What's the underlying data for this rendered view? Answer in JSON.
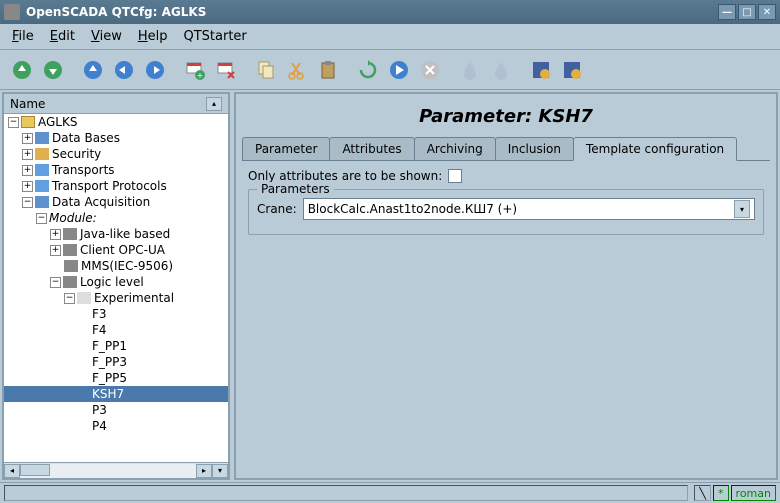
{
  "title": "OpenSCADA QTCfg: AGLKS",
  "menu": {
    "file": "File",
    "edit": "Edit",
    "view": "View",
    "help": "Help",
    "qtstarter": "QTStarter"
  },
  "tree": {
    "header": "Name",
    "root": "AGLKS",
    "databases": "Data Bases",
    "security": "Security",
    "transports": "Transports",
    "transport_protocols": "Transport Protocols",
    "data_acquisition": "Data Acquisition",
    "module": "Module:",
    "java_like": "Java-like based",
    "opc_ua": "Client OPC-UA",
    "mms": "MMS(IEC-9506)",
    "logic_level": "Logic level",
    "experimental": "Experimental",
    "items": [
      "F3",
      "F4",
      "F_PP1",
      "F_PP3",
      "F_PP5",
      "KSH7",
      "P3",
      "P4"
    ],
    "selected": "KSH7"
  },
  "content": {
    "title": "Parameter: KSH7",
    "tabs": {
      "parameter": "Parameter",
      "attributes": "Attributes",
      "archiving": "Archiving",
      "inclusion": "Inclusion",
      "template_config": "Template configuration"
    },
    "only_attrs_label": "Only attributes are to be shown:",
    "parameters_legend": "Parameters",
    "crane_label": "Crane:",
    "crane_value": "BlockCalc.Anast1to2node.КШ7 (+)"
  },
  "status": {
    "indicator": "*",
    "user": "roman"
  }
}
